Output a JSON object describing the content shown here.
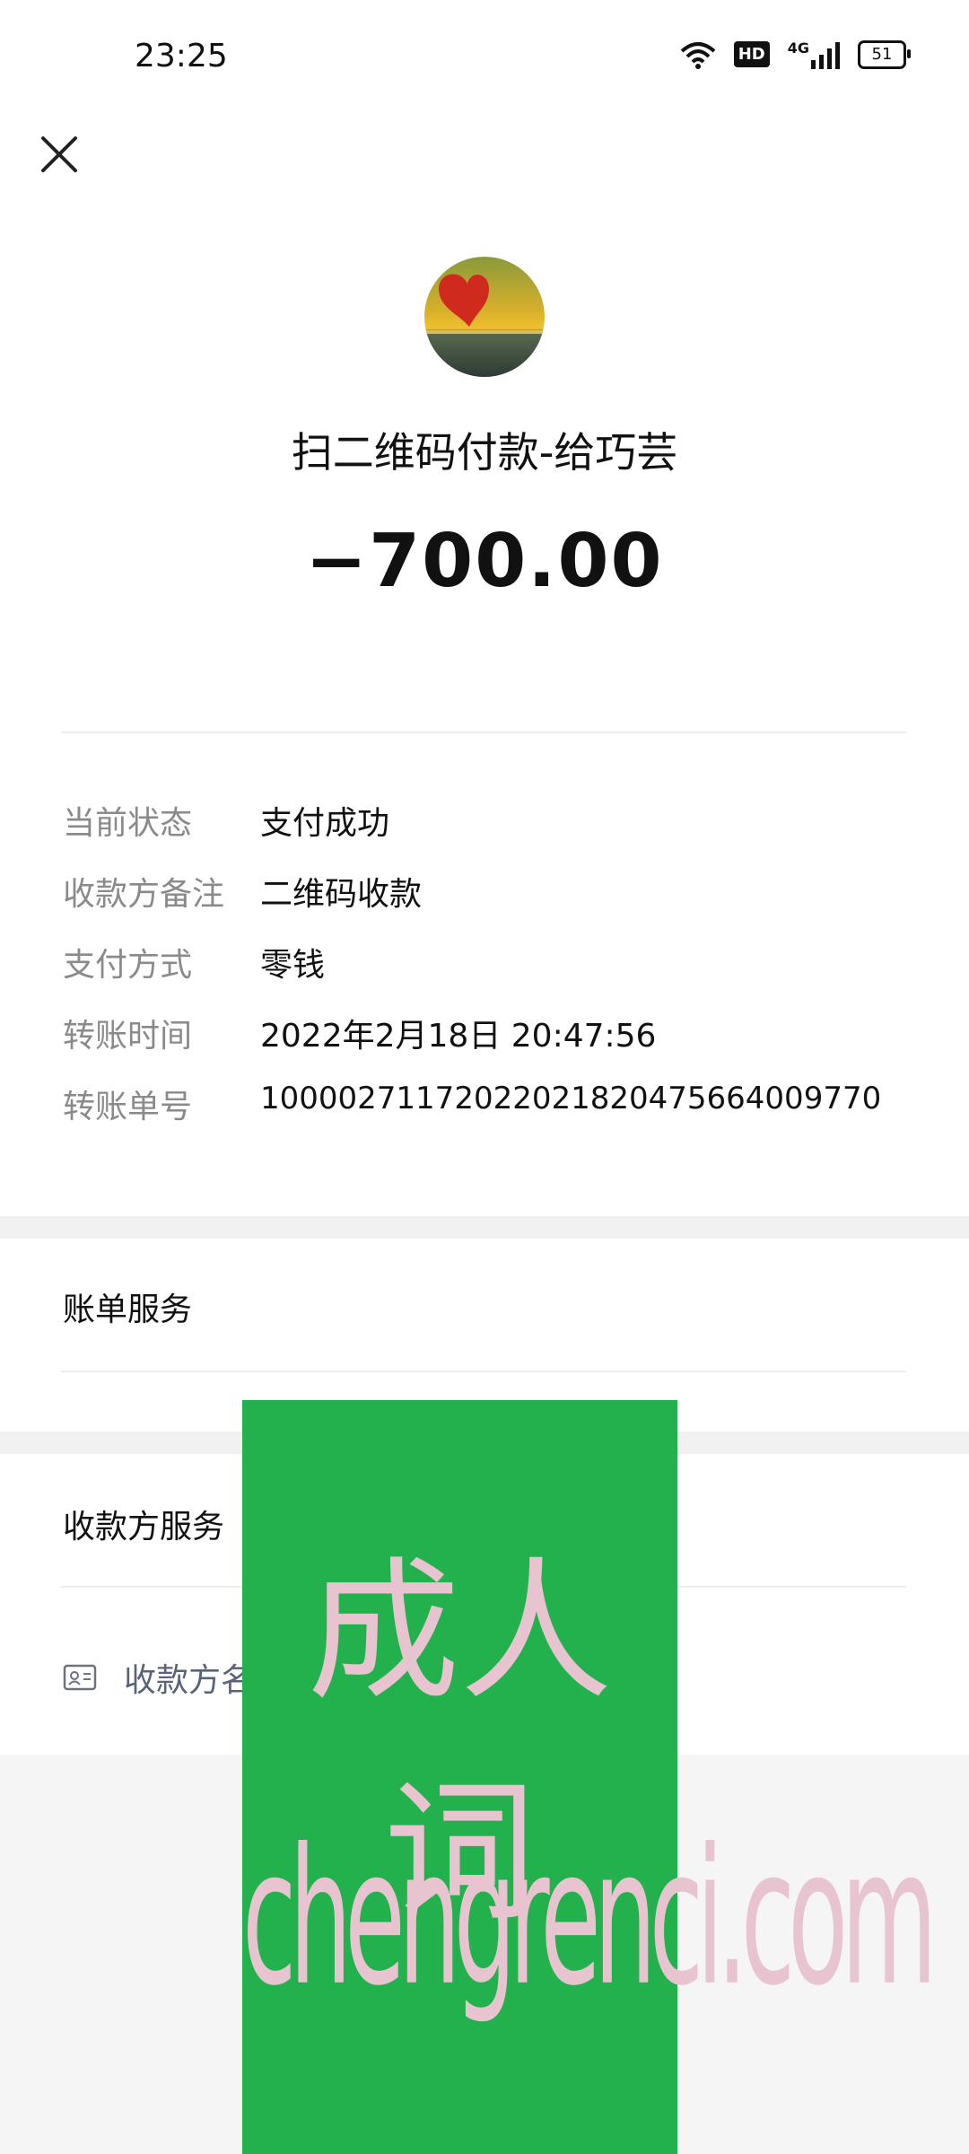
{
  "status_bar": {
    "time": "23:25",
    "hd_label": "HD",
    "network_label": "4G",
    "battery": "51"
  },
  "header": {
    "close_icon": "close-icon"
  },
  "payment": {
    "title": "扫二维码付款-给巧芸",
    "amount": "−700.00"
  },
  "details": [
    {
      "label": "当前状态",
      "value": "支付成功"
    },
    {
      "label": "收款方备注",
      "value": "二维码收款"
    },
    {
      "label": "支付方式",
      "value": "零钱"
    },
    {
      "label": "转账时间",
      "value": "2022年2月18日 20:47:56"
    },
    {
      "label": "转账单号",
      "value": "100002711720220218204756640097​70"
    }
  ],
  "services": {
    "bill_service": "账单服务",
    "payee_service": "收款方服务",
    "payee_name_partial": "收款方名"
  },
  "watermark": {
    "cn": "成人词",
    "en": "chengrenci.com"
  }
}
